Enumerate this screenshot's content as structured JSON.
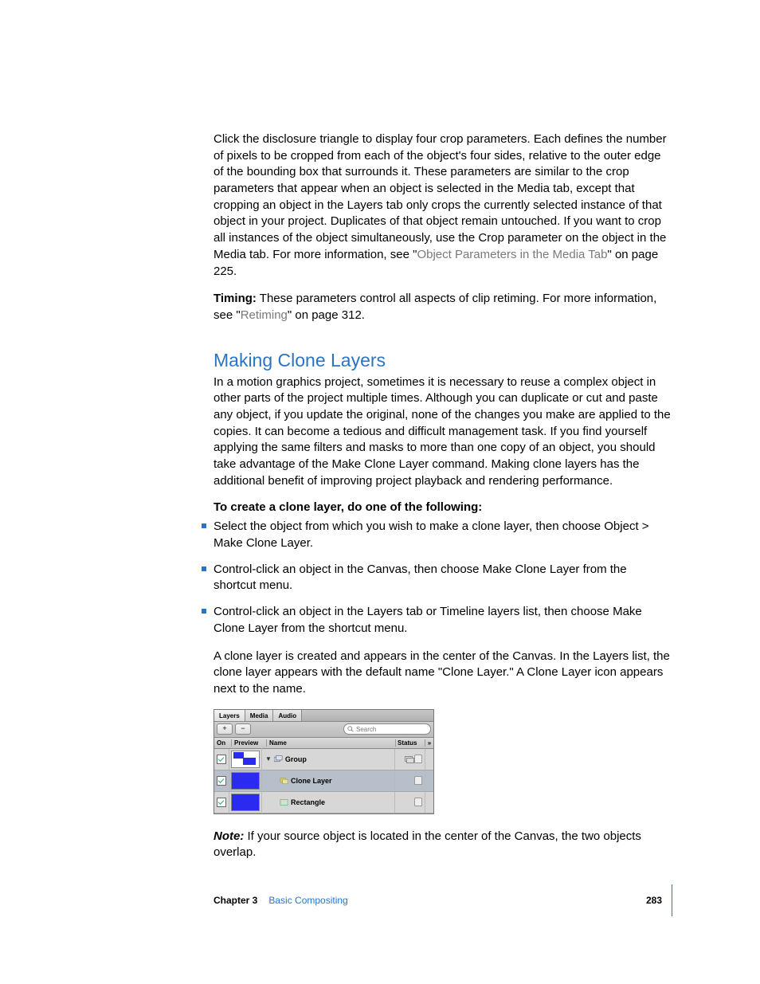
{
  "para1_a": "Click the disclosure triangle to display four crop parameters. Each defines the number of pixels to be cropped from each of the object's four sides, relative to the outer edge of the bounding box that surrounds it. These parameters are similar to the crop parameters that appear when an object is selected in the Media tab, except that cropping an object in the Layers tab only crops the currently selected instance of that object in your project. Duplicates of that object remain untouched. If you want to crop all instances of the object simultaneously, use the Crop parameter on the object in the Media tab. For more information, see \"",
  "para1_link": "Object Parameters in the Media Tab",
  "para1_b": "\" on page 225.",
  "timing_label": "Timing:",
  "timing_a": "  These parameters control all aspects of clip retiming. For more information, see \"",
  "timing_link": "Retiming",
  "timing_b": "\" on page 312.",
  "heading": "Making Clone Layers",
  "para2": "In a motion graphics project, sometimes it is necessary to reuse a complex object in other parts of the project multiple times. Although you can duplicate or cut and paste any object, if you update the original, none of the changes you make are applied to the copies. It can become a tedious and difficult management task. If you find yourself applying the same filters and masks to more than one copy of an object, you should take advantage of the Make Clone Layer command. Making clone layers has the additional benefit of improving project playback and rendering performance.",
  "instr": "To create a clone layer, do one of the following:",
  "bullets": [
    "Select the object from which you wish to make a clone layer, then choose Object > Make Clone Layer.",
    "Control-click an object in the Canvas, then choose Make Clone Layer from the shortcut menu.",
    "Control-click an object in the Layers tab or Timeline layers list, then choose Make Clone Layer from the shortcut menu."
  ],
  "para3": "A clone layer is created and appears in the center of the Canvas. In the Layers list, the clone layer appears with the default name \"Clone Layer.\" A Clone Layer icon appears next to the name.",
  "note_label": "Note:",
  "note_text": "  If your source object is located in the center of the Canvas, the two objects overlap.",
  "panel": {
    "tabs": [
      "Layers",
      "Media",
      "Audio"
    ],
    "active_tab": 0,
    "btn_plus": "+",
    "btn_minus": "−",
    "search_placeholder": "Search",
    "columns": {
      "on": "On",
      "preview": "Preview",
      "name": "Name",
      "status": "Status",
      "ext": "»"
    },
    "rows": [
      {
        "name": "Group",
        "indent": 0,
        "tri": "▼",
        "selected": false,
        "thumb": "group",
        "stack": true
      },
      {
        "name": "Clone Layer",
        "indent": 1,
        "tri": "",
        "selected": true,
        "thumb": "solid",
        "stack": false
      },
      {
        "name": "Rectangle",
        "indent": 1,
        "tri": "",
        "selected": false,
        "thumb": "solid",
        "stack": false
      }
    ]
  },
  "footer": {
    "chapter": "Chapter 3",
    "title": "Basic Compositing",
    "page": "283"
  }
}
